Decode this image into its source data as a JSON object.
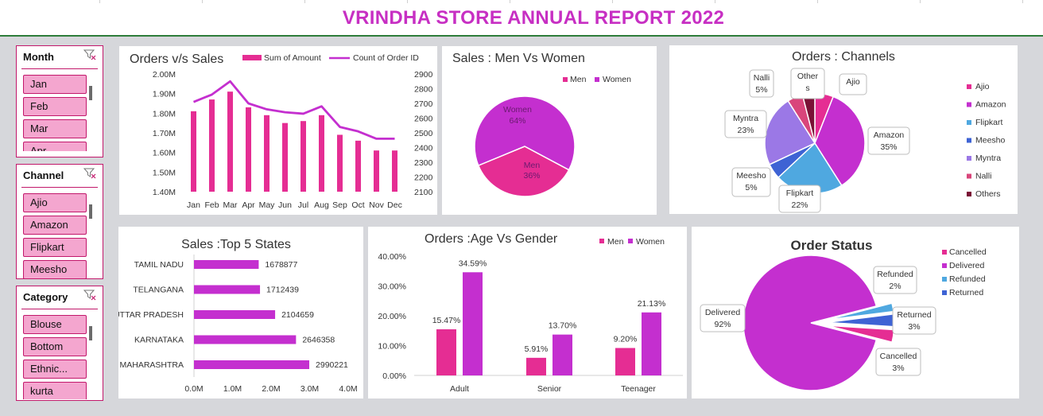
{
  "header": {
    "title": "VRINDHA STORE ANNUAL REPORT 2022"
  },
  "colors": {
    "accent": "#c72fc3",
    "pink": "#e52d93",
    "purple": "#c42fcf",
    "border": "#c2186b"
  },
  "slicers": [
    {
      "title": "Month",
      "items": [
        "Jan",
        "Feb",
        "Mar",
        "Apr"
      ]
    },
    {
      "title": "Channel",
      "items": [
        "Ajio",
        "Amazon",
        "Flipkart",
        "Meesho"
      ]
    },
    {
      "title": "Category",
      "items": [
        "Blouse",
        "Bottom",
        "Ethnic...",
        "kurta"
      ]
    }
  ],
  "icons": {
    "slicer_filter": "clear-filter-icon"
  },
  "chart_data": [
    {
      "id": "orders-vs-sales",
      "type": "bar+line",
      "title": "Orders v/s Sales",
      "categories": [
        "Jan",
        "Feb",
        "Mar",
        "Apr",
        "May",
        "Jun",
        "Jul",
        "Aug",
        "Sep",
        "Oct",
        "Nov",
        "Dec"
      ],
      "series": [
        {
          "name": "Sum of Amount",
          "type": "bar",
          "axis": "left",
          "values": [
            1810000,
            1870000,
            1910000,
            1830000,
            1790000,
            1750000,
            1760000,
            1790000,
            1690000,
            1660000,
            1610000,
            1610000
          ]
        },
        {
          "name": "Count of Order ID",
          "type": "line",
          "axis": "right",
          "values": [
            2710,
            2760,
            2850,
            2700,
            2660,
            2640,
            2630,
            2680,
            2540,
            2510,
            2460,
            2460
          ]
        }
      ],
      "ylim_left": [
        1400000,
        2000000
      ],
      "yticks_left": [
        "2.00M",
        "1.90M",
        "1.80M",
        "1.70M",
        "1.60M",
        "1.50M",
        "1.40M"
      ],
      "ylim_right": [
        2100,
        2900
      ],
      "yticks_right": [
        "2900",
        "2800",
        "2700",
        "2600",
        "2500",
        "2400",
        "2300",
        "2200",
        "2100"
      ],
      "legend": "top"
    },
    {
      "id": "men-vs-women",
      "type": "pie",
      "title": "Sales : Men Vs Women",
      "legend_labels": [
        "Men",
        "Women"
      ],
      "slices": [
        {
          "name": "Men",
          "label": "Men",
          "value": 36,
          "value_label": "36%",
          "color": "#e52d93"
        },
        {
          "name": "Women",
          "label": "Women",
          "value": 64,
          "value_label": "64%",
          "color": "#c42fcf"
        }
      ]
    },
    {
      "id": "channels",
      "type": "pie",
      "title": "Orders : Channels",
      "slices": [
        {
          "name": "Ajio",
          "value": 6,
          "label": "Ajio",
          "value_label": "",
          "color": "#e52d93"
        },
        {
          "name": "Amazon",
          "value": 35,
          "label": "Amazon",
          "value_label": "35%",
          "color": "#c42fcf"
        },
        {
          "name": "Flipkart",
          "value": 22,
          "label": "Flipkart",
          "value_label": "22%",
          "color": "#4fa8e0"
        },
        {
          "name": "Meesho",
          "value": 5,
          "label": "Meesho",
          "value_label": "5%",
          "color": "#3e63d4"
        },
        {
          "name": "Myntra",
          "value": 23,
          "label": "Myntra",
          "value_label": "23%",
          "color": "#9b78e6"
        },
        {
          "name": "Nalli",
          "value": 5,
          "label": "Nalli",
          "value_label": "5%",
          "color": "#d9457b"
        },
        {
          "name": "Others",
          "value": 4,
          "label": "Other s",
          "value_label": "",
          "color": "#7a1236"
        }
      ],
      "legend": "right"
    },
    {
      "id": "top-states",
      "type": "bar",
      "title": "Sales :Top 5 States",
      "categories": [
        "TAMIL NADU",
        "TELANGANA",
        "UTTAR PRADESH",
        "KARNATAKA",
        "MAHARASHTRA"
      ],
      "values": [
        1678877,
        1712439,
        2104659,
        2646358,
        2990221
      ],
      "value_labels": [
        "1678877",
        "1712439",
        "2104659",
        "2646358",
        "2990221"
      ],
      "xlim": [
        0,
        4000000
      ],
      "xticks": [
        "0.0M",
        "1.0M",
        "2.0M",
        "3.0M",
        "4.0M"
      ],
      "orientation": "horizontal"
    },
    {
      "id": "age-vs-gender",
      "type": "bar",
      "title": "Orders :Age Vs Gender",
      "categories": [
        "Adult",
        "Senior",
        "Teenager"
      ],
      "series": [
        {
          "name": "Men",
          "values": [
            15.47,
            5.91,
            9.2
          ],
          "value_labels": [
            "15.47%",
            "5.91%",
            "9.20%"
          ],
          "color": "#e52d93"
        },
        {
          "name": "Women",
          "values": [
            34.59,
            13.7,
            21.13
          ],
          "value_labels": [
            "34.59%",
            "13.70%",
            "21.13%"
          ],
          "color": "#c42fcf"
        }
      ],
      "ylim": [
        0,
        40
      ],
      "yticks": [
        "40.00%",
        "30.00%",
        "20.00%",
        "10.00%",
        "0.00%"
      ],
      "legend": "top-right"
    },
    {
      "id": "order-status",
      "type": "pie",
      "title": "Order Status",
      "slices": [
        {
          "name": "Cancelled",
          "value": 3,
          "label": "Cancelled",
          "value_label": "3%",
          "color": "#e52d93"
        },
        {
          "name": "Delivered",
          "value": 92,
          "label": "Delivered",
          "value_label": "92%",
          "color": "#c42fcf"
        },
        {
          "name": "Refunded",
          "value": 2,
          "label": "Refunded",
          "value_label": "2%",
          "color": "#4fa8e0"
        },
        {
          "name": "Returned",
          "value": 3,
          "label": "Returned",
          "value_label": "3%",
          "color": "#3e63d4"
        }
      ],
      "legend": "top-right"
    }
  ]
}
